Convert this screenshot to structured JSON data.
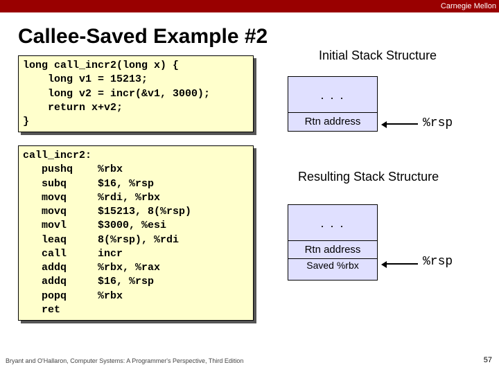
{
  "brand": "Carnegie Mellon",
  "title": "Callee-Saved Example #2",
  "code_c": "long call_incr2(long x) {\n    long v1 = 15213;\n    long v2 = incr(&v1, 3000);\n    return x+v2;\n}",
  "code_asm": "call_incr2:\n   pushq    %rbx\n   subq     $16, %rsp\n   movq     %rdi, %rbx\n   movq     $15213, 8(%rsp)\n   movl     $3000, %esi\n   leaq     8(%rsp), %rdi\n   call     incr\n   addq     %rbx, %rax\n   addq     $16, %rsp\n   popq     %rbx\n   ret",
  "labels": {
    "initial": "Initial Stack Structure",
    "resulting": "Resulting Stack Structure"
  },
  "stack1": {
    "dots": ". . .",
    "rtn": "Rtn address"
  },
  "stack2": {
    "dots": ". . .",
    "rtn": "Rtn address",
    "saved": "Saved\n%rbx"
  },
  "rsp": "%rsp",
  "footer": "Bryant and O'Hallaron, Computer Systems: A Programmer's Perspective, Third Edition",
  "page": "57"
}
